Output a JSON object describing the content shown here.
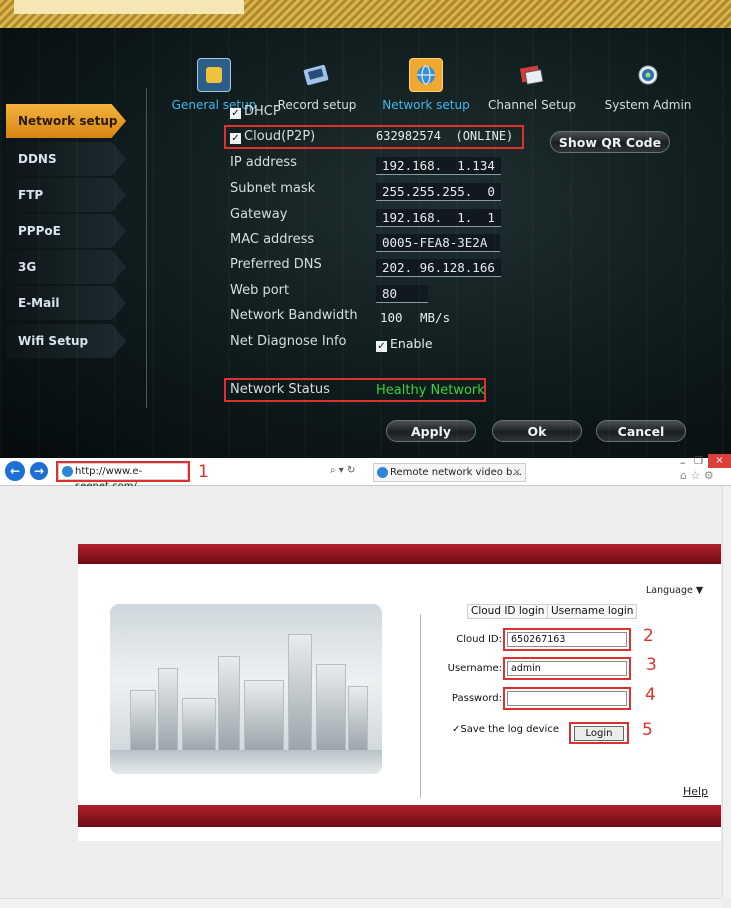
{
  "dvr": {
    "tabs": [
      {
        "label": "General setup",
        "icon": "gear-icon",
        "active": false
      },
      {
        "label": "Record setup",
        "icon": "record-icon",
        "active": false
      },
      {
        "label": "Network setup",
        "icon": "globe-icon",
        "active": true
      },
      {
        "label": "Channel Setup",
        "icon": "channel-icon",
        "active": false
      },
      {
        "label": "System Admin",
        "icon": "admin-icon",
        "active": false
      }
    ],
    "sidebar": [
      {
        "label": "Network setup"
      },
      {
        "label": "DDNS"
      },
      {
        "label": "FTP"
      },
      {
        "label": "PPPoE"
      },
      {
        "label": "3G"
      },
      {
        "label": "E-Mail"
      },
      {
        "label": "Wifi Setup"
      }
    ],
    "dhcp_label": "DHCP",
    "cloud": {
      "label": "Cloud(P2P)",
      "value": "632982574  (ONLINE)"
    },
    "show_qr_label": "Show QR Code",
    "fields": [
      {
        "label": "IP address",
        "value": "192.168.  1.134"
      },
      {
        "label": "Subnet mask",
        "value": "255.255.255.  0"
      },
      {
        "label": "Gateway",
        "value": "192.168.  1.  1"
      },
      {
        "label": "MAC address",
        "value": "0005-FEA8-3E2A"
      },
      {
        "label": "Preferred DNS",
        "value": "202. 96.128.166"
      },
      {
        "label": "Web port",
        "value": "80"
      }
    ],
    "bandwidth": {
      "label": "Network Bandwidth",
      "value": "100",
      "unit": "MB/s"
    },
    "diagnose": {
      "label": "Net Diagnose Info",
      "value": "Enable"
    },
    "status": {
      "label": "Network Status",
      "value": "Healthy Network"
    },
    "buttons": {
      "apply": "Apply",
      "ok": "Ok",
      "cancel": "Cancel"
    },
    "colors": {
      "accent_orange": "#f0a830",
      "active_tab_text": "#45b6e8",
      "healthy_green": "#39d43a",
      "highlight_red": "#e0302e"
    }
  },
  "browser": {
    "address": "http://www.e-seenet.com/",
    "tab_title": "Remote network video b...",
    "annotations": [
      "1",
      "2",
      "3",
      "4",
      "5"
    ],
    "page": {
      "language_label": "Language ▼",
      "login_tabs": [
        "Cloud ID login",
        "Username login"
      ],
      "cloud_id": {
        "label": "Cloud ID:",
        "value": "650267163"
      },
      "username": {
        "label": "Username:",
        "value": "admin"
      },
      "password": {
        "label": "Password:",
        "value": ""
      },
      "save_device": "Save the log device",
      "login_button": "Login",
      "help_link": "Help"
    }
  }
}
